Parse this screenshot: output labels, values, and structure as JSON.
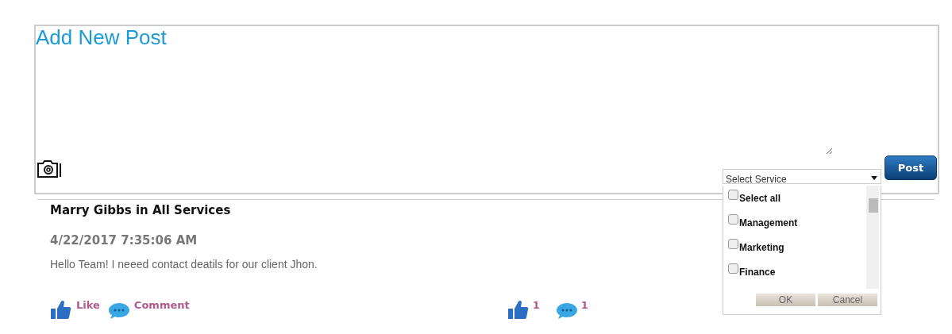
{
  "composer": {
    "title": "Add New Post",
    "post_button": "Post"
  },
  "service_select": {
    "placeholder": "Select Service",
    "options": [
      {
        "label": "Select all",
        "checked": false
      },
      {
        "label": "Management",
        "checked": false
      },
      {
        "label": "Marketing",
        "checked": false
      },
      {
        "label": "Finance",
        "checked": false
      }
    ],
    "buttons": [
      "OK",
      "Cancel"
    ]
  },
  "post": {
    "author_line": "Marry Gibbs in All Services",
    "timestamp": "4/22/2017 7:35:06 AM",
    "body": "Hello Team! I neeed contact deatils for our client Jhon.",
    "actions": {
      "like": "Like",
      "comment": "Comment",
      "like_count": "1",
      "comment_count": "1"
    }
  }
}
